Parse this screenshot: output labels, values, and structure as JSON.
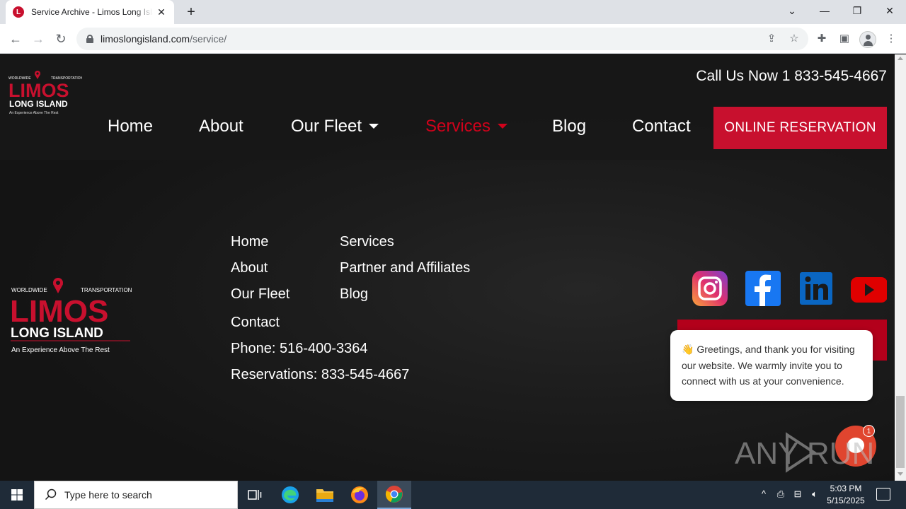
{
  "browser": {
    "tab_title": "Service Archive - Limos Long Island",
    "tab_close": "✕",
    "new_tab": "+",
    "url_host": "limoslongisland.com",
    "url_path": "/service/"
  },
  "window": {
    "minimize": "—",
    "maximize": "❐",
    "close": "✕",
    "tab_search": "⌄"
  },
  "header": {
    "call": "Call Us Now 1 833-545-4667",
    "nav": {
      "home": "Home",
      "about": "About",
      "fleet": "Our Fleet",
      "services": "Services",
      "blog": "Blog",
      "contact": "Contact"
    },
    "reserve": "ONLINE RESERVATION",
    "active_color": "#d0021b",
    "accent_color": "#c8102e"
  },
  "logo": {
    "top_left": "WORLDWIDE",
    "top_right": "TRANSPORTATION",
    "main": "LIMOS",
    "sub": "LONG ISLAND",
    "tagline": "An Experience Above The Rest"
  },
  "footer": {
    "links_col1": [
      "Home",
      "About",
      "Our Fleet",
      "Contact"
    ],
    "links_col2": [
      "Services",
      "Partner and Affiliates",
      "Blog"
    ],
    "phone": "Phone: 516-400-3364",
    "reservations": "Reservations: 833-545-4667",
    "social": [
      "instagram-icon",
      "facebook-icon",
      "linkedin-icon",
      "youtube-icon"
    ]
  },
  "chat": {
    "message": "Greetings, and thank you for visiting our website. We warmly invite you to connect with us at your convenience.",
    "emoji": "👋",
    "badge": "1"
  },
  "watermark": "ANY RUN",
  "taskbar": {
    "search_placeholder": "Type here to search",
    "time": "5:03 PM",
    "date": "5/15/2025"
  }
}
